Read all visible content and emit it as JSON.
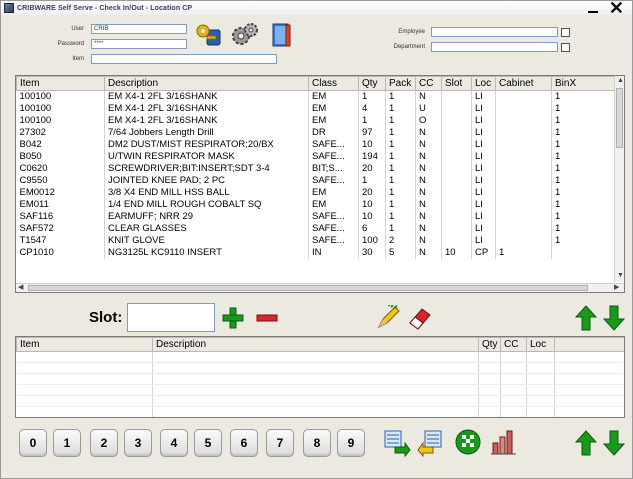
{
  "window": {
    "title": "CRIBWARE Self Serve - Check In/Out - Location CP"
  },
  "header": {
    "user_label": "User",
    "user_value": "CRIB",
    "password_label": "Password",
    "password_value": "****",
    "item_label": "Item",
    "item_value": "",
    "employee_label": "Employee",
    "employee_value": "",
    "department_label": "Department",
    "department_value": ""
  },
  "main_grid": {
    "columns": [
      "Item",
      "Description",
      "Class",
      "Qty",
      "Pack",
      "CC",
      "Slot",
      "Loc",
      "Cabinet",
      "BinX"
    ],
    "rows": [
      [
        "100100",
        "EM X4-1 2FL 3/16SHANK",
        "EM",
        "1",
        "1",
        "N",
        "",
        "LI",
        "",
        "1"
      ],
      [
        "100100",
        "EM X4-1 2FL 3/16SHANK",
        "EM",
        "4",
        "1",
        "U",
        "",
        "LI",
        "",
        "1"
      ],
      [
        "100100",
        "EM X4-1 2FL 3/16SHANK",
        "EM",
        "1",
        "1",
        "O",
        "",
        "LI",
        "",
        "1"
      ],
      [
        "27302",
        "7/64 Jobbers Length Drill",
        "DR",
        "97",
        "1",
        "N",
        "",
        "LI",
        "",
        "1"
      ],
      [
        "B042",
        "DM2 DUST/MIST RESPIRATOR;20/BX",
        "SAFE...",
        "10",
        "1",
        "N",
        "",
        "LI",
        "",
        "1"
      ],
      [
        "B050",
        "U/TWIN RESPIRATOR MASK",
        "SAFE...",
        "194",
        "1",
        "N",
        "",
        "LI",
        "",
        "1"
      ],
      [
        "C0620",
        "SCREWDRIVER;BIT:INSERT;SDT 3-4",
        "BIT;S...",
        "20",
        "1",
        "N",
        "",
        "LI",
        "",
        "1"
      ],
      [
        "C9550",
        "JOINTED KNEE PAD; 2 PC",
        "SAFE...",
        "1",
        "1",
        "N",
        "",
        "LI",
        "",
        "1"
      ],
      [
        "EM0012",
        "3/8 X4 END MILL HSS  BALL",
        "EM",
        "20",
        "1",
        "N",
        "",
        "LI",
        "",
        "1"
      ],
      [
        "EM011",
        "1/4 END MILL ROUGH COBALT SQ",
        "EM",
        "10",
        "1",
        "N",
        "",
        "LI",
        "",
        "1"
      ],
      [
        "SAF116",
        "EARMUFF; NRR 29",
        "SAFE...",
        "10",
        "1",
        "N",
        "",
        "LI",
        "",
        "1"
      ],
      [
        "SAF572",
        "CLEAR GLASSES",
        "SAFE...",
        "6",
        "1",
        "N",
        "",
        "LI",
        "",
        "1"
      ],
      [
        "T1547",
        "KNIT GLOVE",
        "SAFE...",
        "100",
        "2",
        "N",
        "",
        "LI",
        "",
        "1"
      ],
      [
        "CP1010",
        "NG3125L KC9110 INSERT",
        "IN",
        "30",
        "5",
        "N",
        "10",
        "CP",
        "1",
        ""
      ]
    ]
  },
  "slot": {
    "label": "Slot:",
    "value": ""
  },
  "lower_grid": {
    "columns": [
      "Item",
      "Description",
      "Qty",
      "CC",
      "Loc"
    ]
  },
  "keypad": {
    "keys": [
      "0",
      "1",
      "2",
      "3",
      "4",
      "5",
      "6",
      "7",
      "8",
      "9"
    ]
  },
  "icons": {
    "header": [
      "key-lock-icon",
      "gears-icon",
      "book-icon"
    ],
    "slot": [
      "add-icon",
      "remove-icon"
    ],
    "edit": [
      "pencil-icon",
      "eraser-icon"
    ],
    "bottom": [
      "checkout-icon",
      "checkin-icon",
      "finish-flag-icon",
      "reports-icon"
    ],
    "nav": [
      "arrow-up-icon",
      "arrow-down-icon"
    ]
  },
  "colors": {
    "accent_green": "#1a9a1a",
    "accent_red": "#d9262c",
    "window_bg": "#ece9e1"
  }
}
